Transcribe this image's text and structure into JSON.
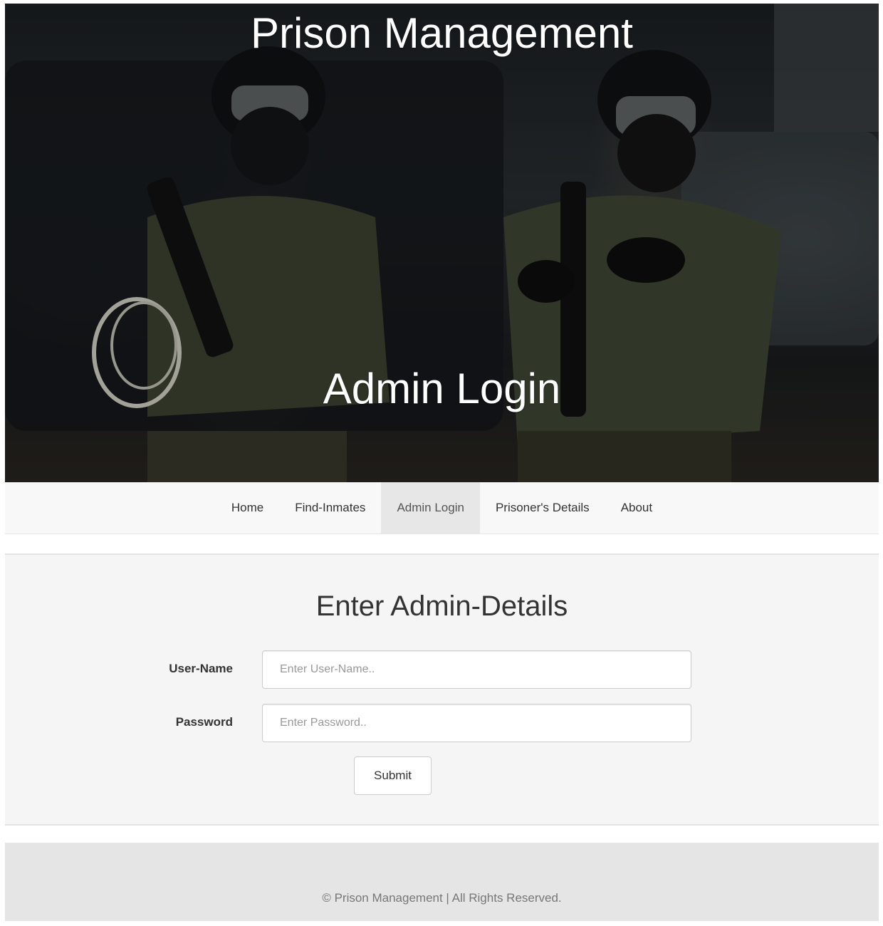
{
  "hero": {
    "title": "Prison Management",
    "subtitle": "Admin Login"
  },
  "nav": {
    "items": [
      {
        "label": "Home"
      },
      {
        "label": "Find-Inmates"
      },
      {
        "label": "Admin Login",
        "active": true
      },
      {
        "label": "Prisoner's Details"
      },
      {
        "label": "About"
      }
    ]
  },
  "form": {
    "heading": "Enter Admin-Details",
    "username_label": "User-Name",
    "username_placeholder": "Enter User-Name..",
    "password_label": "Password",
    "password_placeholder": "Enter Password..",
    "submit_label": "Submit"
  },
  "footer": {
    "text": "© Prison Management | All Rights Reserved."
  }
}
